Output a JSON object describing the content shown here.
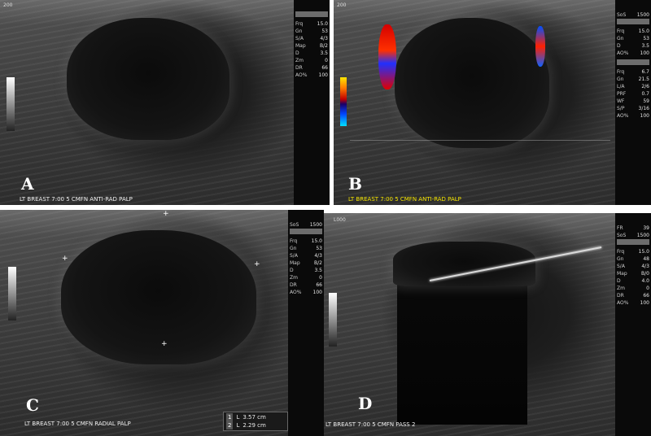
{
  "panels": [
    {
      "id": "A",
      "letter": "A",
      "caption": "LT BREAST 7:00 5 CMFN ANTI-RAD PALP",
      "corner": "200",
      "sidebar": {
        "rows": [
          {
            "k": "Frq",
            "v": "15.0"
          },
          {
            "k": "Gn",
            "v": "53"
          },
          {
            "k": "S/A",
            "v": "4/3"
          },
          {
            "k": "Map",
            "v": "B/2"
          },
          {
            "k": "D",
            "v": "3.5"
          },
          {
            "k": "Zm",
            "v": "0"
          },
          {
            "k": "DR",
            "v": "66"
          },
          {
            "k": "AO%",
            "v": "100"
          }
        ]
      }
    },
    {
      "id": "B",
      "letter": "B",
      "caption": "LT BREAST 7:00 5 CMFN ANTI-RAD PALP",
      "corner": "200",
      "sidebar": {
        "header": {
          "k": "SoS",
          "v": "1500"
        },
        "rows": [
          {
            "k": "Frq",
            "v": "15.0"
          },
          {
            "k": "Gn",
            "v": "53"
          },
          {
            "k": "D",
            "v": "3.5"
          },
          {
            "k": "AO%",
            "v": "100"
          },
          {
            "k": "Frq",
            "v": "6.7"
          },
          {
            "k": "Gn",
            "v": "21.5"
          },
          {
            "k": "L/A",
            "v": "2/6"
          },
          {
            "k": "PRF",
            "v": "0.7"
          },
          {
            "k": "WF",
            "v": "59"
          },
          {
            "k": "S/P",
            "v": "3/16"
          },
          {
            "k": "AO%",
            "v": "100"
          }
        ]
      }
    },
    {
      "id": "C",
      "letter": "C",
      "caption": "LT BREAST 7:00 5 CMFN RADIAL PALP",
      "corner": "",
      "sidebar": {
        "header": {
          "k": "SoS",
          "v": "1500"
        },
        "rows": [
          {
            "k": "Frq",
            "v": "15.0"
          },
          {
            "k": "Gn",
            "v": "53"
          },
          {
            "k": "S/A",
            "v": "4/3"
          },
          {
            "k": "Map",
            "v": "B/2"
          },
          {
            "k": "D",
            "v": "3.5"
          },
          {
            "k": "Zm",
            "v": "0"
          },
          {
            "k": "DR",
            "v": "66"
          },
          {
            "k": "AO%",
            "v": "100"
          }
        ]
      },
      "measurements": [
        {
          "idx": "1",
          "label": "L",
          "value": "3.57 cm"
        },
        {
          "idx": "2",
          "label": "L",
          "value": "2.29 cm"
        }
      ]
    },
    {
      "id": "D",
      "letter": "D",
      "caption": "LT BREAST 7:00 5 CMFN PASS 2",
      "corner": "L000",
      "sidebar": {
        "header": {
          "k": "FR",
          "v": "39"
        },
        "rows": [
          {
            "k": "SoS",
            "v": "1500"
          },
          {
            "k": "Frq",
            "v": "15.0"
          },
          {
            "k": "Gn",
            "v": "48"
          },
          {
            "k": "S/A",
            "v": "4/3"
          },
          {
            "k": "Map",
            "v": "B/0"
          },
          {
            "k": "D",
            "v": "4.0"
          },
          {
            "k": "Zm",
            "v": "0"
          },
          {
            "k": "DR",
            "v": "66"
          },
          {
            "k": "AO%",
            "v": "100"
          }
        ]
      }
    }
  ]
}
